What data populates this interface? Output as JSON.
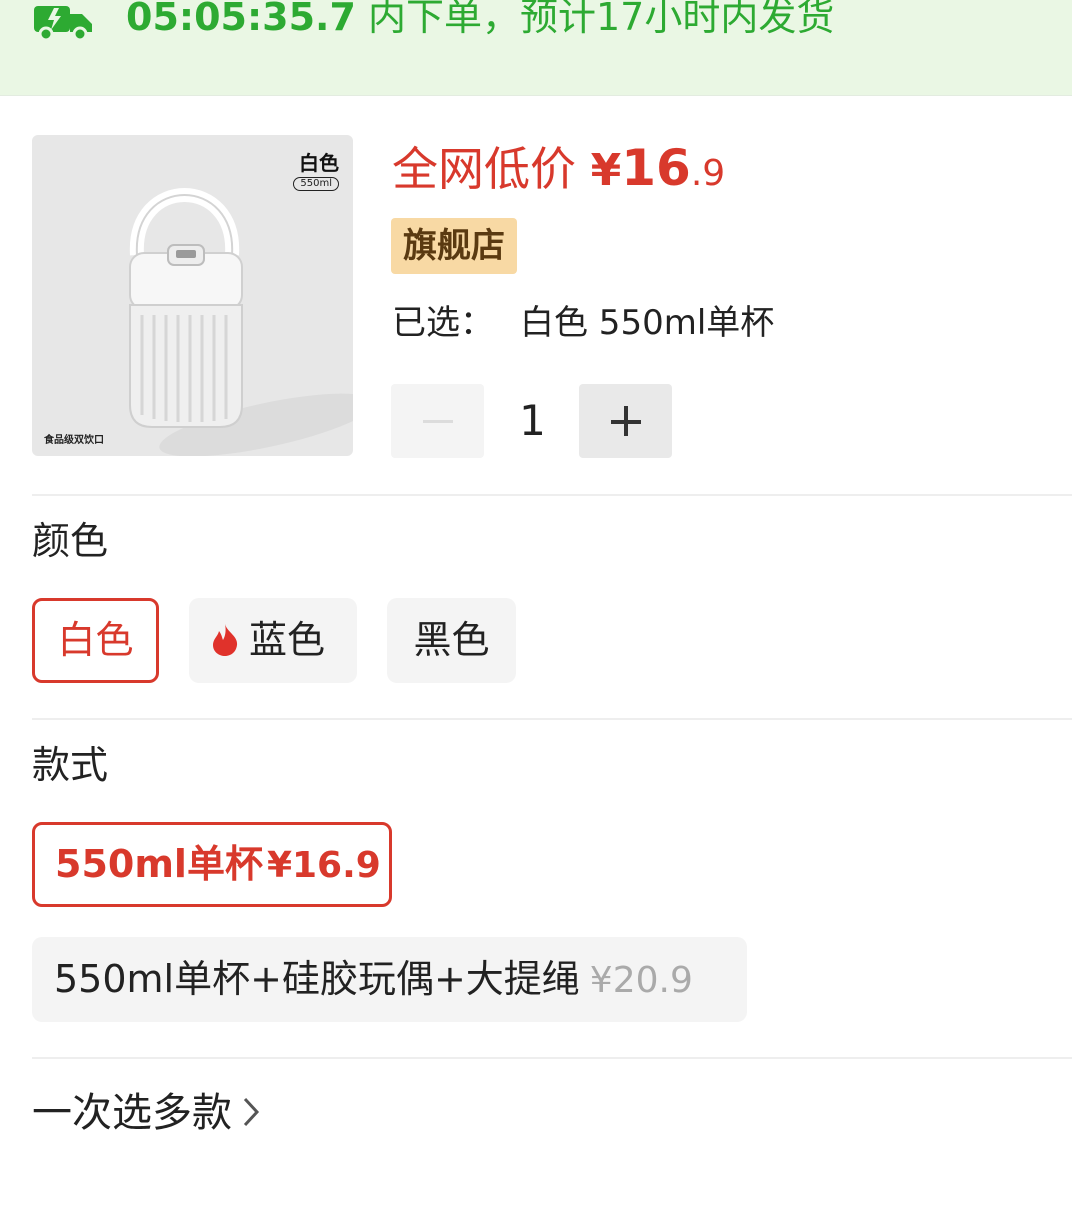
{
  "banner": {
    "icon": "delivery-truck-icon",
    "countdown": "05:05:35.7",
    "message": " 内下单，预计17小时内发货",
    "color": "#2daa32"
  },
  "product": {
    "image_color_label": "白色",
    "image_capacity_label": "550ml",
    "image_footer_label": "食品级双饮口",
    "price_prefix": "全网低价 ",
    "price_currency": "¥",
    "price_integer": "16",
    "price_decimal": ".9",
    "store_badge": "旗舰店",
    "selected_label": "已选：",
    "selected_value": "白色 550ml单杯",
    "quantity": "1"
  },
  "color_section": {
    "title": "颜色",
    "options": [
      {
        "label": "白色",
        "selected": true
      },
      {
        "label": "蓝色",
        "selected": false,
        "icon": "flame-icon"
      },
      {
        "label": "黑色",
        "selected": false
      }
    ]
  },
  "style_section": {
    "title": "款式",
    "options": [
      {
        "label": "550ml单杯",
        "price": "¥16.9",
        "selected": true
      },
      {
        "label": "550ml单杯+硅胶玩偶+大提绳",
        "price": "¥20.9",
        "selected": false
      }
    ]
  },
  "multi_select": {
    "label": "一次选多款",
    "icon": "chevron-right-icon"
  },
  "colors": {
    "accent_red": "#d8392c",
    "banner_bg": "#eaf7e4",
    "badge_bg": "#f8d9a4"
  }
}
